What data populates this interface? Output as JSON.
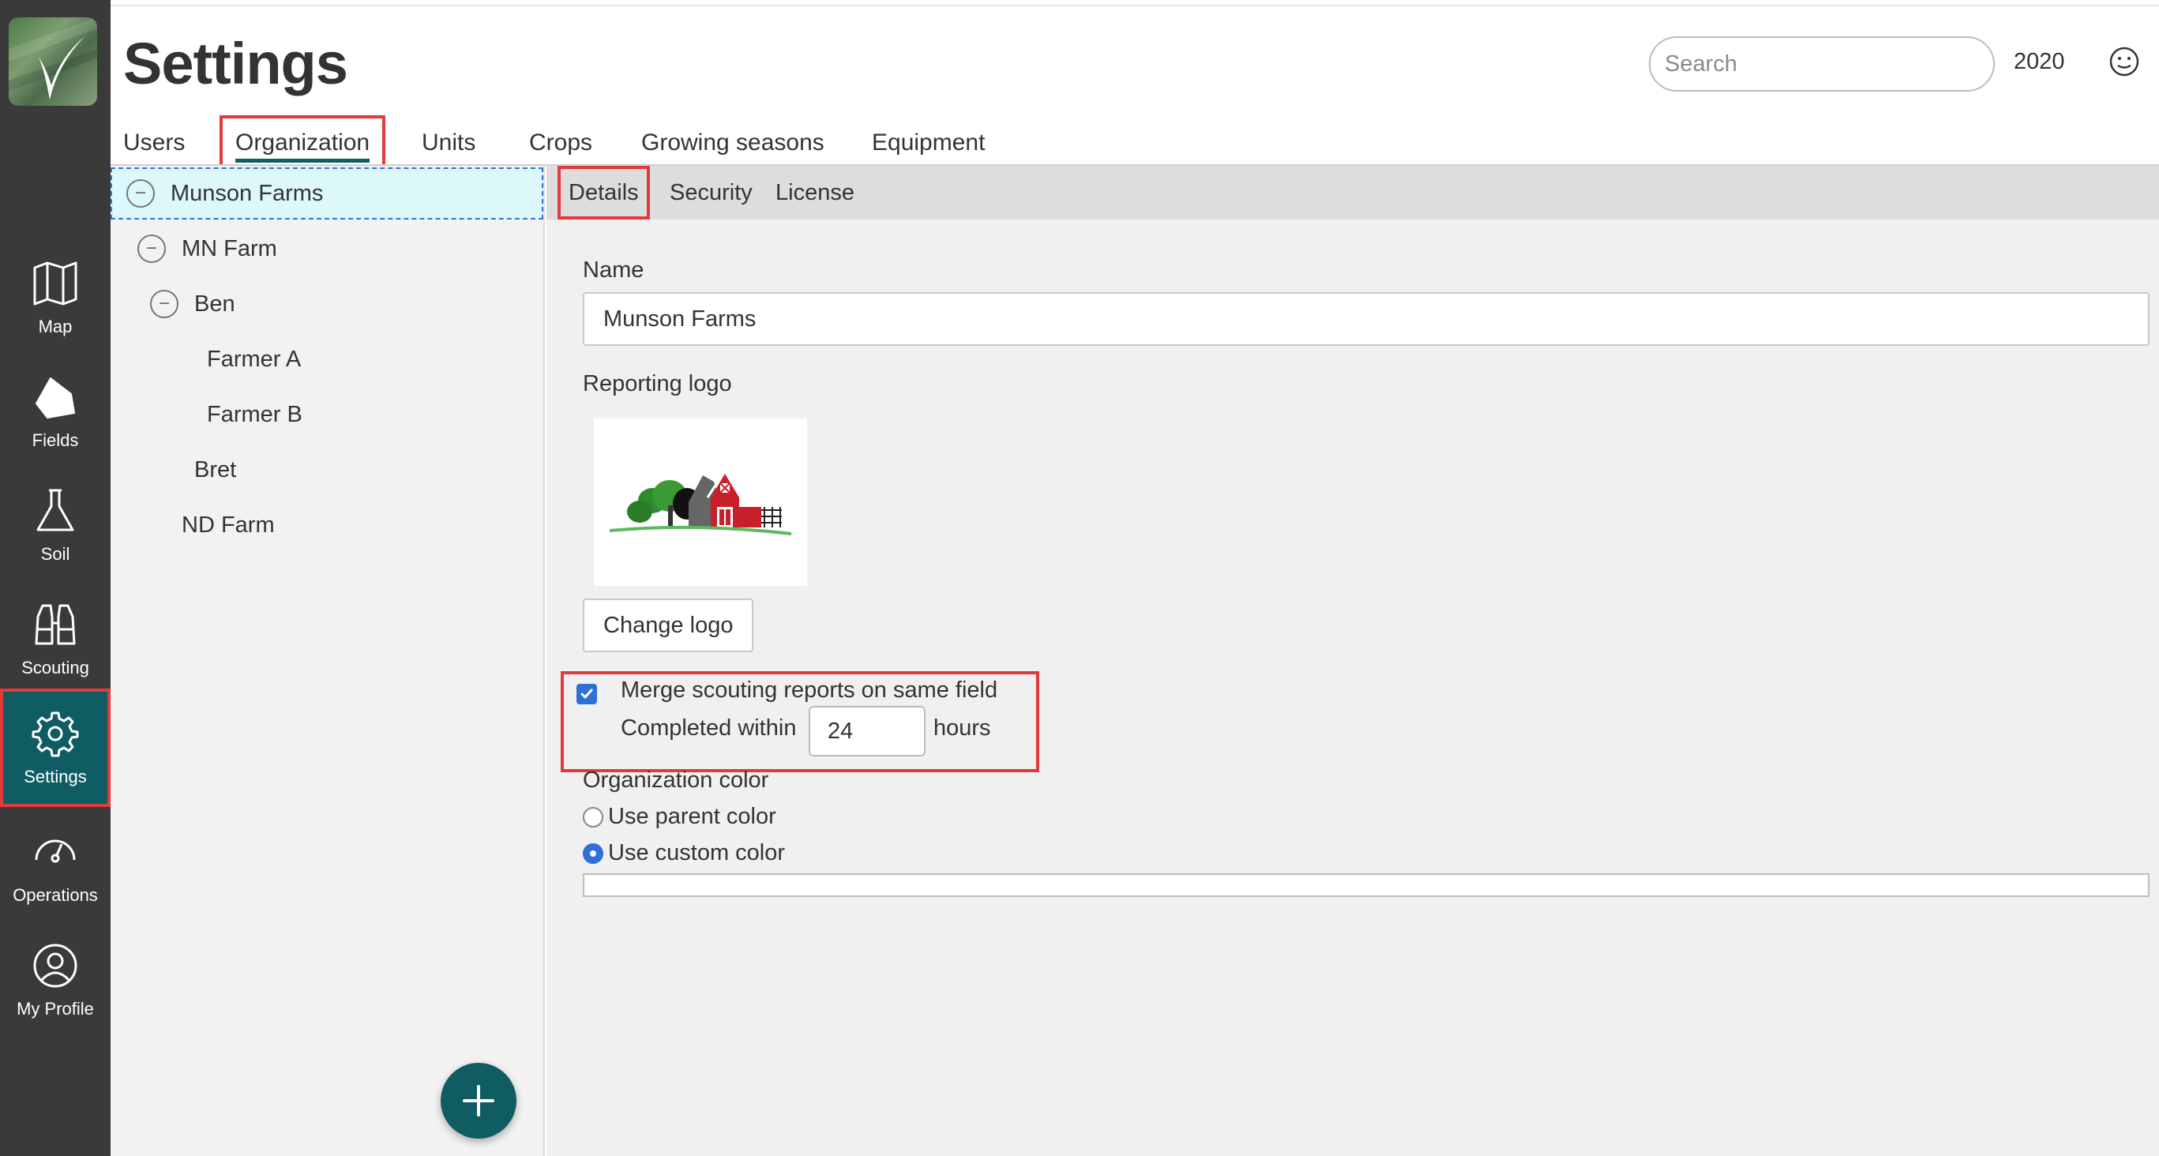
{
  "header": {
    "title": "Settings",
    "search_placeholder": "Search",
    "year": "2020"
  },
  "nav": {
    "items": [
      {
        "label": "Map",
        "icon": "map-icon"
      },
      {
        "label": "Fields",
        "icon": "field-icon"
      },
      {
        "label": "Soil",
        "icon": "flask-icon"
      },
      {
        "label": "Scouting",
        "icon": "binoculars-icon"
      },
      {
        "label": "Settings",
        "icon": "gear-icon",
        "active": true
      },
      {
        "label": "Operations",
        "icon": "gauge-icon"
      },
      {
        "label": "My Profile",
        "icon": "user-icon"
      }
    ]
  },
  "tabs": [
    "Users",
    "Organization",
    "Units",
    "Crops",
    "Growing seasons",
    "Equipment"
  ],
  "active_tab": "Organization",
  "tree": [
    {
      "label": "Munson Farms",
      "toggle": "−",
      "selected": true
    },
    {
      "label": "MN Farm",
      "toggle": "−"
    },
    {
      "label": "Ben",
      "toggle": "−"
    },
    {
      "label": "Farmer A"
    },
    {
      "label": "Farmer B"
    },
    {
      "label": "Bret"
    },
    {
      "label": "ND Farm"
    }
  ],
  "subtabs": [
    "Details",
    "Security",
    "License"
  ],
  "active_subtab": "Details",
  "details": {
    "name_label": "Name",
    "name_value": "Munson Farms",
    "logo_label": "Reporting logo",
    "change_logo": "Change logo",
    "merge_label": "Merge scouting reports on same field",
    "merge_checked": true,
    "completed_within": "Completed within",
    "hours_value": "24",
    "hours_unit": "hours",
    "org_color_label": "Organization color",
    "use_parent": "Use parent color",
    "use_custom": "Use custom color",
    "selected_color_option": "custom"
  },
  "colors": {
    "accent": "#0f5d63",
    "highlight": "#e33b3b",
    "checkbox": "#2f6fd8",
    "rail": "#3a3a3a"
  }
}
